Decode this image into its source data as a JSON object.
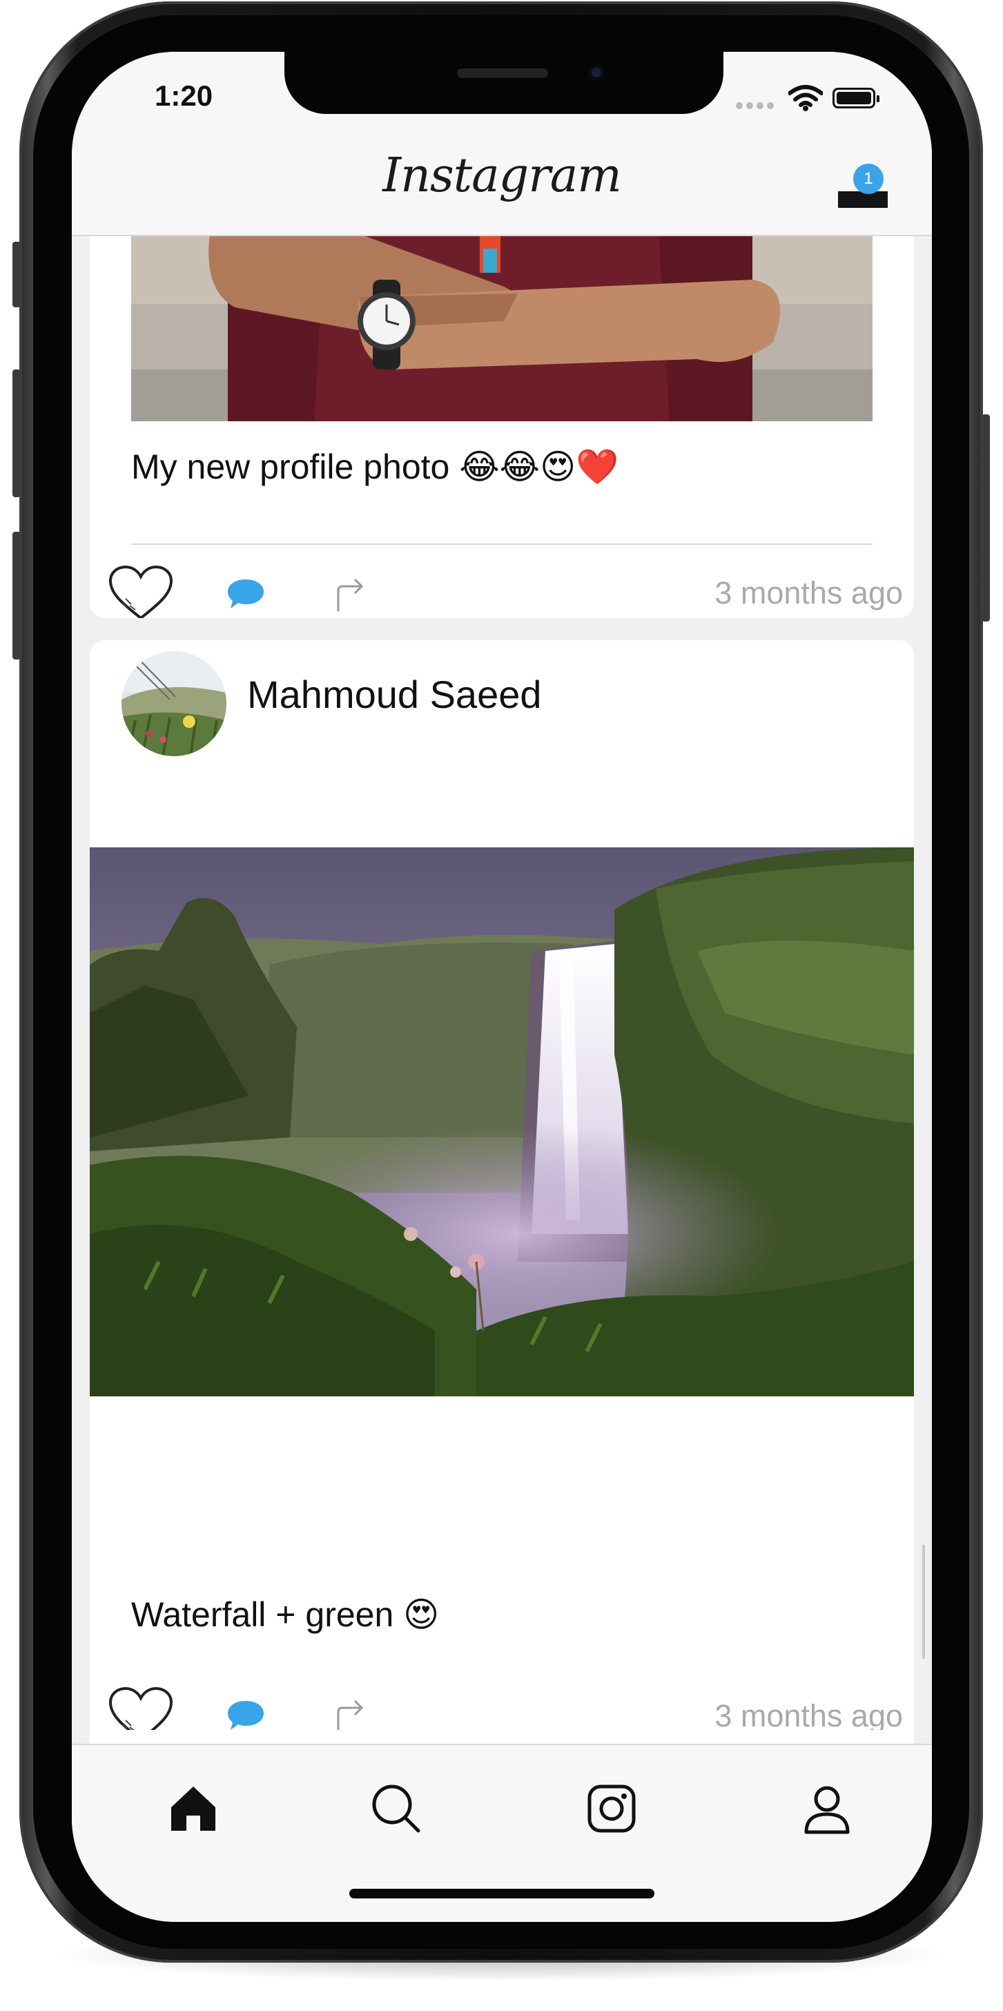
{
  "status_bar": {
    "time": "1:20"
  },
  "header": {
    "title": "Instagram",
    "inbox_badge": "1"
  },
  "posts": [
    {
      "caption": "My new profile photo 😂😂😍❤️",
      "timestamp": "3 months ago",
      "photo": "man-crossed-arms-watch"
    },
    {
      "author": "Mahmoud Saeed",
      "avatar": "meadow-flower-avatar",
      "photo": "waterfall-landscape",
      "caption": "Waterfall + green 😍",
      "timestamp": "3 months ago"
    }
  ],
  "tabs": [
    {
      "icon": "home-icon",
      "active": true
    },
    {
      "icon": "search-icon",
      "active": false
    },
    {
      "icon": "camera-icon",
      "active": false
    },
    {
      "icon": "profile-icon",
      "active": false
    }
  ],
  "colors": {
    "accent": "#3aa4ea",
    "timestamp": "#a9a9a9",
    "heart": "#e02020",
    "screen_bg": "#f0f0f0"
  }
}
